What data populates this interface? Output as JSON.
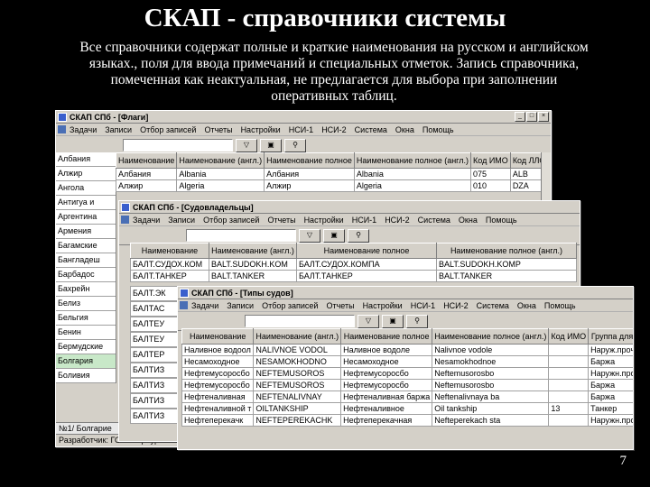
{
  "slide": {
    "title": "СКАП - справочники системы",
    "text_lines": [
      "Все справочники содержат полные и краткие наименования на русском и английском",
      "языках., поля для ввода примечаний и специальных отметок. Запись справочника,",
      "помеченная как неактуальная, не предлагается для выбора при заполнении",
      "оперативных таблиц."
    ],
    "page_number": "7"
  },
  "win1": {
    "title": "СКАП СПб - [Флаги]",
    "menu": [
      "Задачи",
      "Записи",
      "Отбор записей",
      "Отчеты",
      "Настройки",
      "НСИ-1",
      "НСИ-2",
      "Система",
      "Окна",
      "Помощь"
    ],
    "columns": [
      "Наименование",
      "Наименование (англ.)",
      "Наименование полное",
      "Наименование полное (англ.)",
      "Код ИМО",
      "Код ЛЛОЙДА",
      "Ак"
    ],
    "rows": [
      [
        "Албания",
        "Albania",
        "Албания",
        "Albania",
        "075",
        "ALB"
      ],
      [
        "Алжир",
        "Algeria",
        "Алжир",
        "Algeria",
        "010",
        "DZA"
      ]
    ],
    "side_rows": [
      "Албания",
      "Алжир",
      "Ангола",
      "Антигуа и",
      "Аргентина",
      "Армения",
      "Багамские",
      "Бангладеш",
      "Барбадос",
      "Бахрейн",
      "Белиз",
      "Бельгия",
      "Бенин",
      "Бермудские",
      "Болгария",
      "Боливия"
    ],
    "status_left": "№1/ Болгарие",
    "status": "Разработчик: ГС-Петербург"
  },
  "win2": {
    "title": "СКАП СПб - [Судовладельцы]",
    "menu": [
      "Задачи",
      "Записи",
      "Отбор записей",
      "Отчеты",
      "Настройки",
      "НСИ-1",
      "НСИ-2",
      "Система",
      "Окна",
      "Помощь"
    ],
    "columns": [
      "Наименование",
      "Наименование (англ.)",
      "Наименование полное",
      "Наименование полное (англ.)"
    ],
    "rows": [
      [
        "БАЛТ.СУДОХ.КОМ",
        "BALT.SUDOKH.KOM",
        "БАЛТ.СУДОХ.КОМПА",
        "BALT.SUDOKH.KOMP"
      ],
      [
        "БАЛТ.ТАНКЕР",
        "BALT.TANKER",
        "БАЛТ.ТАНКЕР",
        "BALT.TANKER"
      ]
    ],
    "side_rows": [
      "БАЛТ.ЭК",
      "БАЛТАС",
      "БАЛТЕУ",
      "БАЛТЕУ",
      "БАЛТЕР",
      "БАЛТИЗ",
      "БАЛТИЗ",
      "БАЛТИЗ",
      "БАЛТИЗ"
    ]
  },
  "win3": {
    "title": "СКАП СПб - [Типы судов]",
    "menu": [
      "Задачи",
      "Записи",
      "Отбор записей",
      "Отчеты",
      "Настройки",
      "НСИ-1",
      "НСИ-2",
      "Система",
      "Окна",
      "Помощь"
    ],
    "columns": [
      "Наименование",
      "Наименование (англ.)",
      "Наименование полное",
      "Наименование полное (англ.)",
      "Код ИМО",
      "Группа для отч"
    ],
    "rows": [
      [
        "Наливное водоол",
        "NALIVNOE VODOL",
        "Наливное водоле",
        "Nalivnoe vodole",
        "",
        "Наруж.прочие"
      ],
      [
        "Несамоходное",
        "NESAMOKHODNO",
        "Несамоходное",
        "Nesamokhodnoe",
        "",
        "Баржа"
      ],
      [
        "Нефтемусоросбо",
        "NEFTEMUSOROS",
        "Нефтемусоросбо",
        "Neftemusorosbo",
        "",
        "Наружн.прочие"
      ],
      [
        "Нефтемусоросбо",
        "NEFTEMUSOROS",
        "Нефтемусоросбо",
        "Neftemusorosbo",
        "",
        "Баржа"
      ],
      [
        "Нефтеналивная",
        "NEFTENALIVNAY",
        "Нефтеналивная баржа",
        "Neftenalivnaya ba",
        "",
        "Баржа"
      ],
      [
        "Нефтеналивной т",
        "OILTANKSHIP",
        "Нефтеналивное",
        "Oil tankship",
        "13",
        "Танкер"
      ],
      [
        "Нефтеперекачк",
        "NEFTEPEREKACHK",
        "Нефтеперекачная",
        "Nefteperekach sta",
        "",
        "Наружн.прочие"
      ]
    ]
  }
}
